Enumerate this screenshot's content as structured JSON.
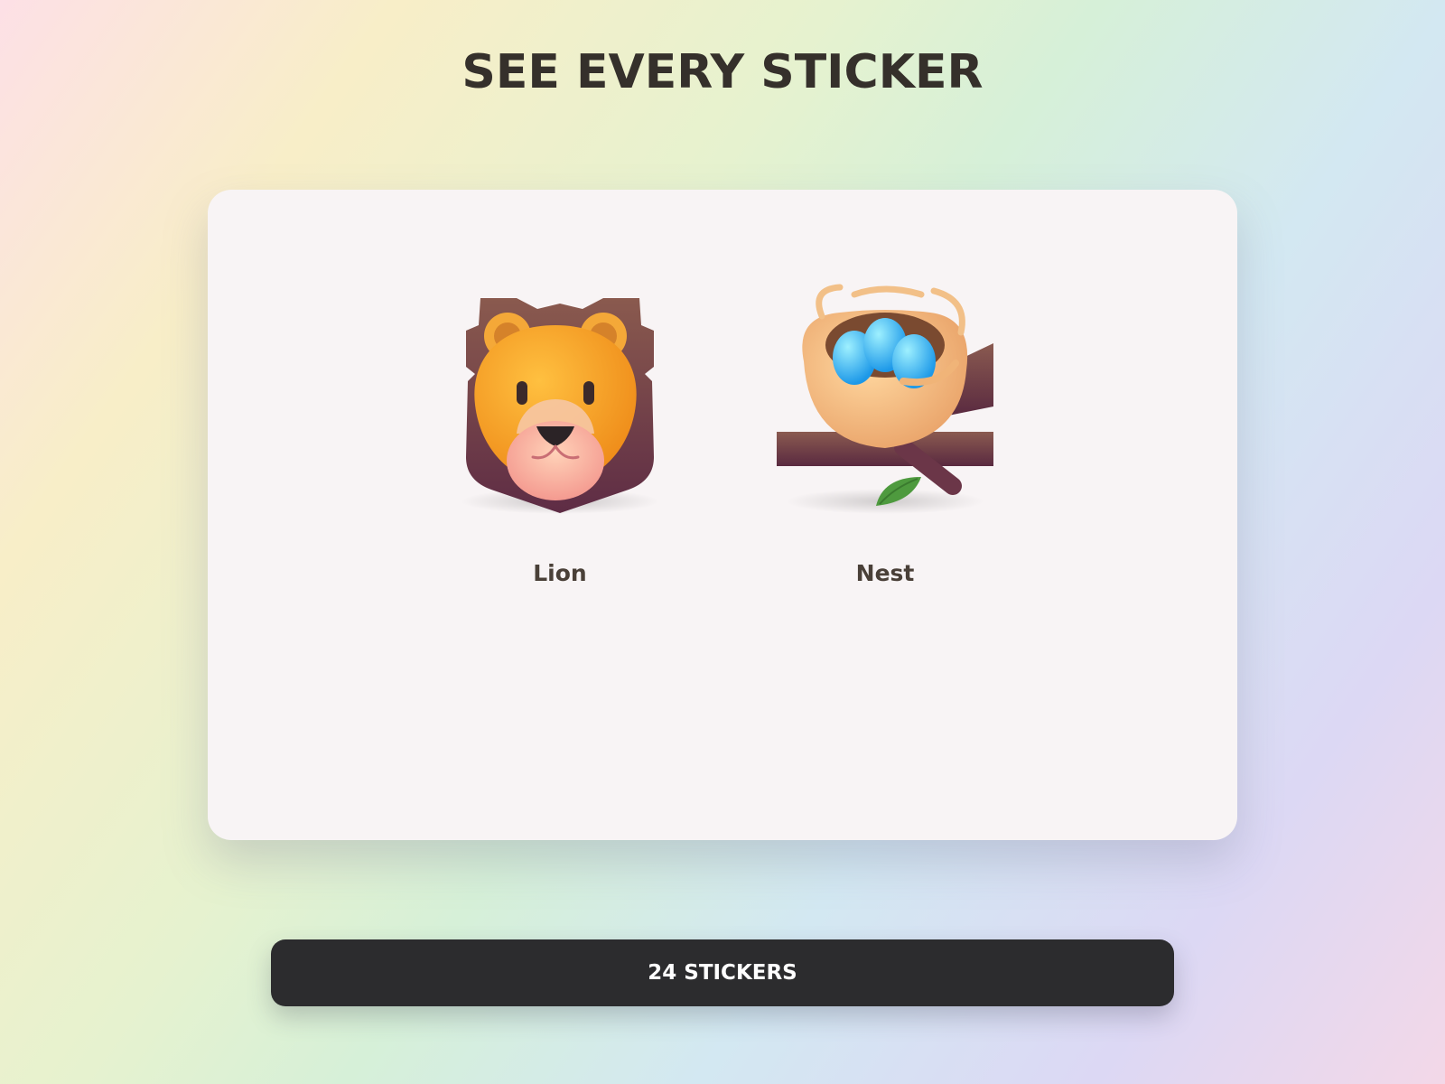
{
  "page": {
    "title": "SEE EVERY STICKER"
  },
  "stickers": [
    {
      "label": "Lion",
      "icon": "lion-icon"
    },
    {
      "label": "Nest",
      "icon": "nest-with-eggs-icon"
    }
  ],
  "footer": {
    "count_label": "24 STICKERS"
  },
  "colors": {
    "title_text": "#35302b",
    "panel_background": "#f8f4f5",
    "button_background": "#2c2c2e",
    "button_text": "#ffffff",
    "label_text": "#4a4038"
  }
}
